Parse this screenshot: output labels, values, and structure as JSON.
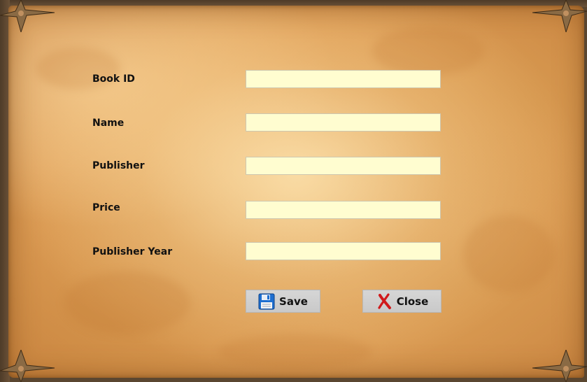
{
  "form": {
    "fields": [
      {
        "label": "Book ID",
        "value": "",
        "placeholder": ""
      },
      {
        "label": "Name",
        "value": "",
        "placeholder": ""
      },
      {
        "label": "Publisher",
        "value": "",
        "placeholder": ""
      },
      {
        "label": "Price",
        "value": "",
        "placeholder": ""
      },
      {
        "label": "Publisher Year",
        "value": "",
        "placeholder": ""
      }
    ]
  },
  "buttons": {
    "save_label": "Save",
    "save_icon": "floppy-disk-icon",
    "close_label": "Close",
    "close_icon": "red-x-icon"
  },
  "colors": {
    "input_background": "#fffdd0",
    "button_background": "#cccccc",
    "parchment": "#e3a860",
    "close_icon_red": "#d0191b",
    "save_icon_blue": "#1e6fd0"
  }
}
